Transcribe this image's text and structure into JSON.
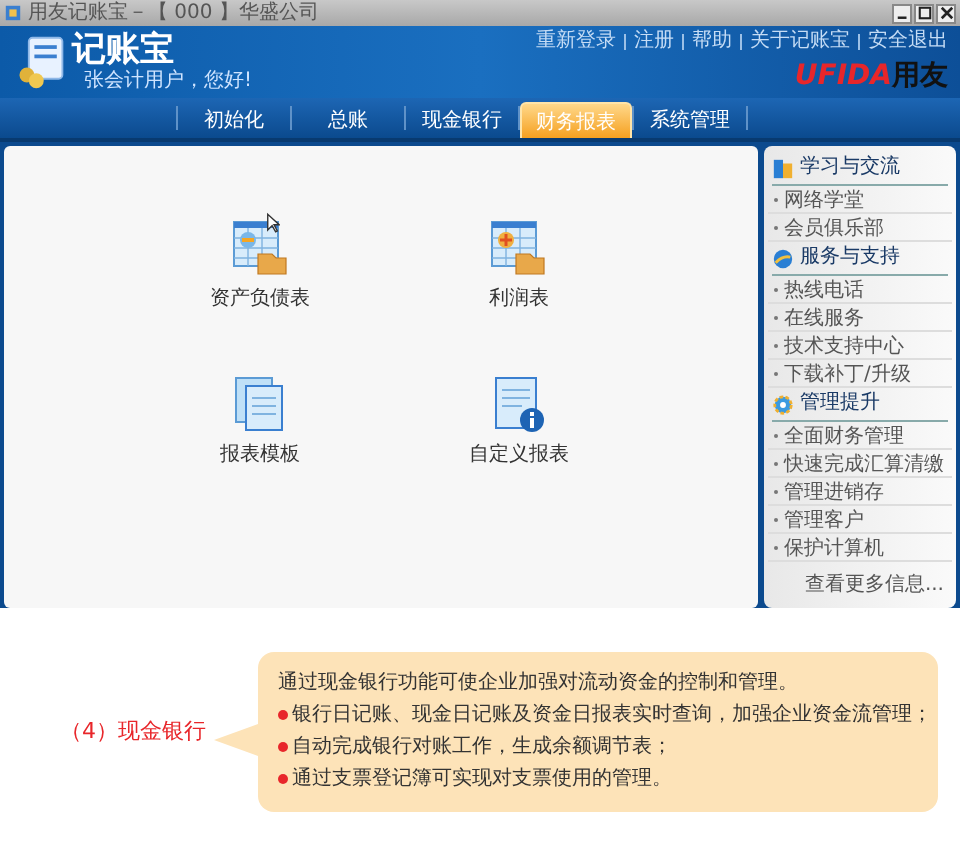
{
  "window": {
    "title": "用友记账宝－【 000 】华盛公司"
  },
  "header": {
    "logo": "记账宝",
    "greeting": "张会计用户，您好!",
    "brand_latin": "UFIDA",
    "brand_cn": "用友",
    "links": [
      "重新登录",
      "注册",
      "帮助",
      "关于记账宝",
      "安全退出"
    ]
  },
  "tabs": [
    {
      "label": "初始化",
      "selected": false
    },
    {
      "label": "总账",
      "selected": false
    },
    {
      "label": "现金银行",
      "selected": false
    },
    {
      "label": "财务报表",
      "selected": true
    },
    {
      "label": "系统管理",
      "selected": false
    }
  ],
  "reports": [
    {
      "label": "资产负债表",
      "kind": "sheet-minus"
    },
    {
      "label": "利润表",
      "kind": "sheet-plus"
    },
    {
      "label": "报表模板",
      "kind": "stack"
    },
    {
      "label": "自定义报表",
      "kind": "info"
    }
  ],
  "sidebar": {
    "sections": [
      {
        "title": "学习与交流",
        "kind": "book",
        "items": [
          "网络学堂",
          "会员俱乐部"
        ]
      },
      {
        "title": "服务与支持",
        "kind": "globe",
        "items": [
          "热线电话",
          "在线服务",
          "技术支持中心",
          "下载补丁/升级"
        ]
      },
      {
        "title": "管理提升",
        "kind": "gear",
        "items": [
          "全面财务管理",
          "快速完成汇算清缴",
          "管理进销存",
          "管理客户",
          "保护计算机"
        ]
      }
    ],
    "more": "查看更多信息..."
  },
  "callout": {
    "label": "（4）现金银行",
    "intro": "通过现金银行功能可使企业加强对流动资金的控制和管理。",
    "points": [
      "银行日记账、现金日记账及资金日报表实时查询，加强企业资金流管理；",
      "自动完成银行对账工作，生成余额调节表；",
      "通过支票登记簿可实现对支票使用的管理。"
    ]
  }
}
